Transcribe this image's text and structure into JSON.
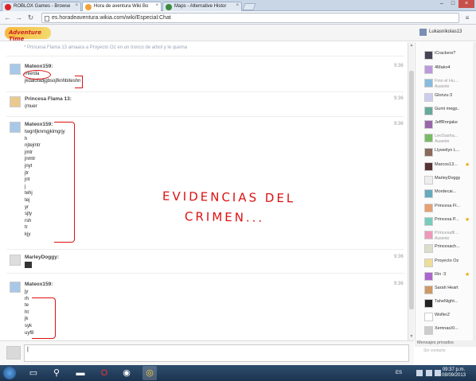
{
  "browser": {
    "tabs": [
      {
        "title": "ROBLOX Games - Browse",
        "active": false
      },
      {
        "title": "Hora de aventura Wiki Bo",
        "active": true
      },
      {
        "title": "Maps - Alternative Histor",
        "active": false
      }
    ],
    "url": "es.horadeaventura.wikia.com/wiki/Especial:Chat"
  },
  "chat": {
    "logo": "Adventure Time",
    "current_user": "Lukasnikolas13",
    "inline_alert": "* Princesa Flama 13 amaara a Proyecto Oz en un tronco de arbol y le quema",
    "messages": [
      {
        "author": "Mateox159:",
        "time": "9:36",
        "lines": [
          "mierda",
          "jkdalofadjgbsojfknhbiteshn"
        ]
      },
      {
        "author": "Princesa Flama 13:",
        "time": "9:36",
        "lines": [
          "(muer"
        ]
      },
      {
        "author": "Mateox159:",
        "time": "9:36",
        "lines": [
          "twgnfjknmgjklmgrjy",
          "h",
          "njtejmtr",
          "jmtr",
          "jnmtr",
          "jnyt",
          "jtr",
          "jnt",
          "j",
          "tehj",
          "tej",
          "yr",
          "sjty",
          "rsh",
          "tr",
          "kjy"
        ]
      },
      {
        "author": "MarleyDoggy:",
        "time": "9:36",
        "lines": []
      },
      {
        "author": "Mateox159:",
        "time": "9:36",
        "lines": [
          "jy",
          "rh",
          "te",
          "ht",
          "jk",
          "syk",
          "uyf8"
        ]
      }
    ],
    "annotation": [
      "EVIDENCIAS DEL",
      "CRIMEN..."
    ],
    "users": [
      {
        "name": "iCrackers?",
        "status": "",
        "star": false
      },
      {
        "name": "4Mako4",
        "status": "",
        "star": false
      },
      {
        "name": "Finn el Hu...",
        "status": "Ausente",
        "star": false
      },
      {
        "name": "Glonzu:3",
        "status": "",
        "star": false
      },
      {
        "name": "Gumi megp...",
        "status": "",
        "star": false
      },
      {
        "name": "JeffRnnjake",
        "status": "",
        "star": false
      },
      {
        "name": "LeoSasha...",
        "status": "Ausente",
        "star": false
      },
      {
        "name": "Llyweilyn L...",
        "status": "",
        "star": false
      },
      {
        "name": "Marcos13...",
        "status": "",
        "star": true
      },
      {
        "name": "MarleyDoggy",
        "status": "",
        "star": false
      },
      {
        "name": "Mordecai...",
        "status": "",
        "star": false
      },
      {
        "name": "Princesa Fl...",
        "status": "",
        "star": false
      },
      {
        "name": "Princesa P...",
        "status": "",
        "star": true
      },
      {
        "name": "Princesafli...",
        "status": "Ausente",
        "star": false
      },
      {
        "name": "Princesach...",
        "status": "",
        "star": false
      },
      {
        "name": "Proyecto Oz",
        "status": "",
        "star": false
      },
      {
        "name": "Rin :3",
        "status": "",
        "star": true
      },
      {
        "name": "Sarah Heart",
        "status": "",
        "star": false
      },
      {
        "name": "TaheNight...",
        "status": "",
        "star": false
      },
      {
        "name": "WolferZ",
        "status": "",
        "star": false
      },
      {
        "name": "XemnasXI...",
        "status": "",
        "star": false
      }
    ],
    "private_label": "Mensajes privados",
    "private_placeholder": "Sin contacto",
    "input_value": "|"
  },
  "taskbar": {
    "lang": "ES",
    "time": "09:37 p.m.",
    "date": "08/09/2013"
  },
  "colors": {
    "annotation": "#d11111",
    "taskbar": "#1b3350",
    "tab_active": "#ffffff"
  }
}
